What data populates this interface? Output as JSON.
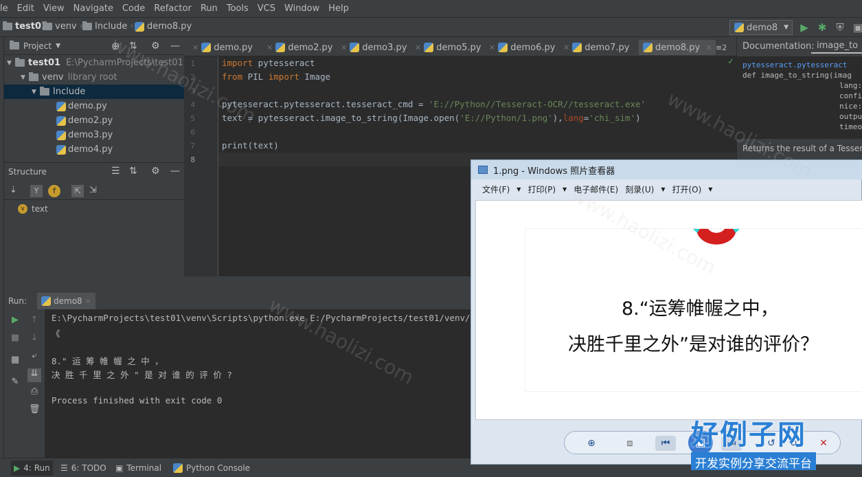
{
  "menubar": {
    "items": [
      "le",
      "Edit",
      "View",
      "Navigate",
      "Code",
      "Refactor",
      "Run",
      "Tools",
      "VCS",
      "Window",
      "Help"
    ]
  },
  "navbar": {
    "crumbs": [
      "test01",
      "venv",
      "Include",
      "demo8.py"
    ],
    "run_config": "demo8"
  },
  "project": {
    "label": "Project",
    "tree": [
      {
        "name": "test01",
        "path": "E:\\PycharmProjects\\test01"
      },
      {
        "name": "venv",
        "note": "library root"
      },
      {
        "name": "Include"
      },
      {
        "name": "demo.py"
      },
      {
        "name": "demo2.py"
      },
      {
        "name": "demo3.py"
      },
      {
        "name": "demo4.py"
      }
    ]
  },
  "structure": {
    "label": "Structure",
    "items": [
      {
        "name": "text",
        "badge": "v"
      }
    ],
    "filter_badge": "f"
  },
  "editor": {
    "tabs": [
      "demo.py",
      "demo2.py",
      "demo3.py",
      "demo5.py",
      "demo6.py",
      "demo7.py",
      "demo8.py"
    ],
    "active_tab": "demo8.py",
    "tabs_overflow": "≡2",
    "line_numbers": [
      "1",
      "2",
      "3",
      "4",
      "5",
      "6",
      "7",
      "8"
    ],
    "lines": {
      "l1_kw": "import",
      "l1_rest": " pytesseract",
      "l2_kw1": "from",
      "l2_mid": " PIL ",
      "l2_kw2": "import",
      "l2_rest": " Image",
      "l4_a": "pytesseract.pytesseract.tesseract_cmd = ",
      "l4_str": "'E://Python//Tesseract-OCR//tesseract.exe'",
      "l5_a": "text = pytesseract.image_to_string(Image.open(",
      "l5_str": "'E://Python/1.png'",
      "l5_b": "),",
      "l5_kw": "lang",
      "l5_c": "=",
      "l5_str2": "'chi_sim'",
      "l5_d": ")",
      "l7": "print(text)"
    }
  },
  "documentation": {
    "label": "Documentation:",
    "tab": "image_to",
    "lines": [
      "pytesseract.pytesseract",
      "def image_to_string(imag",
      "lang:",
      "confi",
      "nice:",
      "outpu",
      "timeo"
    ],
    "returns": "Returns the result of a Tessera"
  },
  "run": {
    "label": "Run:",
    "tab": "demo8",
    "output": [
      "E:\\PycharmProjects\\test01\\venv\\Scripts\\python.exe E:/PycharmProjects/test01/venv/Includ",
      "《",
      "",
      "8.\" 运 筹 帷 幄 之 中 ，",
      "决 胜 千 里 之 外 \" 是 对 谁 的 评 价 ?",
      "",
      "Process finished with exit code 0"
    ]
  },
  "bottombar": {
    "items": [
      "4: Run",
      "6: TODO",
      "Terminal",
      "Python Console"
    ]
  },
  "viewer": {
    "title": "1.png - Windows 照片查看器",
    "menu": [
      "文件(F)",
      "打印(P)",
      "电子邮件(E)",
      "刻录(U)",
      "打开(O)"
    ],
    "image_line1": "8.“运筹帷幄之中，",
    "image_line2": "决胜千里之外”是对谁的评价？"
  },
  "watermark": {
    "text": "www.haolizi.com",
    "brand_main": "好例子网",
    "brand_sub": "开发实例分享交流平台"
  },
  "colors": {
    "ide_bg": "#3c3f41",
    "editor_bg": "#2b2b2b",
    "keyword": "#cc7832",
    "string": "#6a8759",
    "brand_blue": "#2a7fd4"
  }
}
